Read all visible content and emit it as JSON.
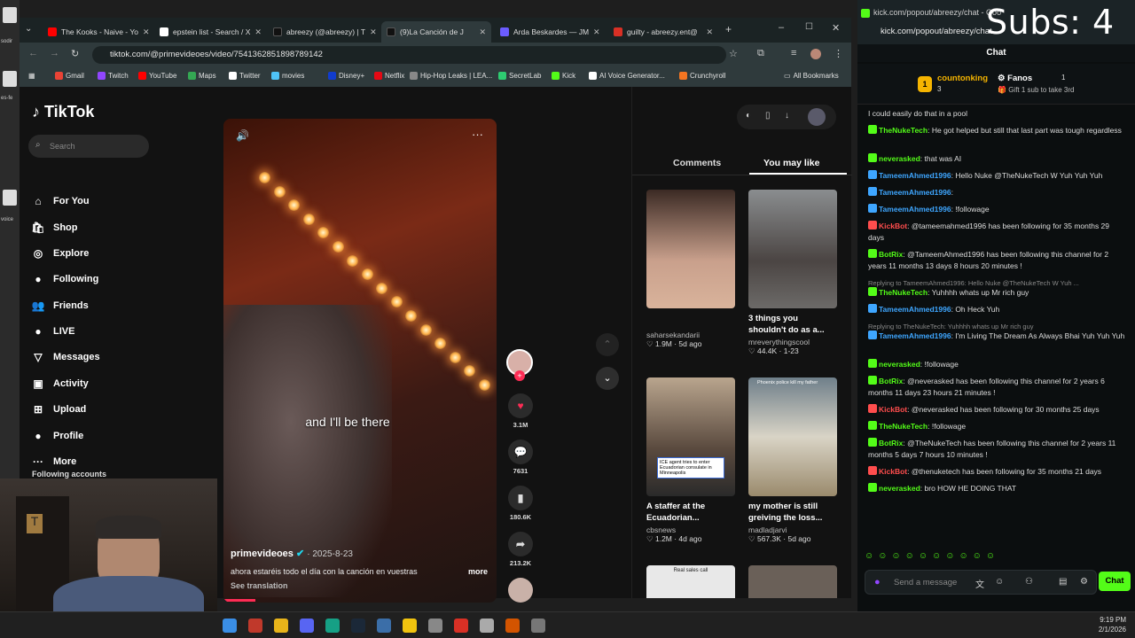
{
  "overlay": {
    "subs": "Subs: 4"
  },
  "desktop": {
    "icons": [
      "sodir",
      "es-fe",
      "voice"
    ]
  },
  "browser": {
    "tabs": [
      {
        "label": "The Kooks - Naive - Yo",
        "color": "#ff0000"
      },
      {
        "label": "epstein list - Search / X",
        "color": "#ffffff"
      },
      {
        "label": "abreezy (@abreezy) | T",
        "color": "#111111"
      },
      {
        "label": "(9)La Canción de J",
        "color": "#111111"
      },
      {
        "label": "Arda Beskardes — JM",
        "color": "#6b5cff"
      },
      {
        "label": "guilty - abreezy.ent@",
        "color": "#d93025"
      }
    ],
    "url": "tiktok.com/@primevideoes/video/7541362851898789142",
    "bookmarks": [
      {
        "label": "Gmail",
        "color": "#ea4335"
      },
      {
        "label": "Twitch",
        "color": "#9146ff"
      },
      {
        "label": "YouTube",
        "color": "#ff0000"
      },
      {
        "label": "Maps",
        "color": "#34a853"
      },
      {
        "label": "Twitter",
        "color": "#ffffff"
      },
      {
        "label": "movies",
        "color": "#4fc3f7"
      },
      {
        "label": "Disney+",
        "color": "#113ccf"
      },
      {
        "label": "Netflix",
        "color": "#e50914"
      },
      {
        "label": "Hip-Hop Leaks | LEA...",
        "color": "#888888"
      },
      {
        "label": "SecretLab",
        "color": "#2ecc71"
      },
      {
        "label": "Kick",
        "color": "#53fc18"
      },
      {
        "label": "AI Voice Generator...",
        "color": "#ffffff"
      },
      {
        "label": "Crunchyroll",
        "color": "#f47521"
      }
    ],
    "all_bookmarks": "All Bookmarks"
  },
  "tiktok": {
    "logo": "TikTok",
    "search_placeholder": "Search",
    "nav": [
      {
        "label": "For You",
        "icon": "⌂"
      },
      {
        "label": "Shop",
        "icon": "🛍"
      },
      {
        "label": "Explore",
        "icon": "◎"
      },
      {
        "label": "Following",
        "icon": "●"
      },
      {
        "label": "Friends",
        "icon": "👥"
      },
      {
        "label": "LIVE",
        "icon": "●"
      },
      {
        "label": "Messages",
        "icon": "▽"
      },
      {
        "label": "Activity",
        "icon": "▣"
      },
      {
        "label": "Upload",
        "icon": "⊞"
      },
      {
        "label": "Profile",
        "icon": "●"
      },
      {
        "label": "More",
        "icon": "···"
      }
    ],
    "following_accounts": "Following accounts",
    "video": {
      "caption": "and I'll be there",
      "author": "primevideoes",
      "date": "· 2025-8-23",
      "description": "ahora estaréis todo el día con la canción en vuestras",
      "more": "more",
      "see_translation": "See translation"
    },
    "actions": {
      "likes": "3.1M",
      "comments": "7631",
      "saves": "180.6K",
      "shares": "213.2K"
    },
    "panel_tabs": {
      "comments": "Comments",
      "you_may_like": "You may like"
    },
    "cards": [
      {
        "title": "",
        "author": "saharsekandarii",
        "stats": "♡ 1.9M · 5d ago",
        "color": "#c9a08c"
      },
      {
        "title": "3 things you shouldn't do as a...",
        "author": "mreverythingscool",
        "stats": "♡ 44.4K · 1-23",
        "color": "#6c6a68"
      },
      {
        "title": "A staffer at the Ecuadorian...",
        "author": "cbsnews",
        "stats": "♡ 1.2M · 4d ago",
        "color": "#8f7d6c"
      },
      {
        "title": "my mother is still greiving the loss...",
        "author": "madladjarvi",
        "stats": "♡ 567.3K · 5d ago",
        "color": "#b7a88f"
      }
    ],
    "card_overlays": {
      "ice": "ICE agent tries to enter Ecuadorian consulate in Minneapolis",
      "phoenix": "Phoenix police kill my father",
      "sales": "Real sales call"
    }
  },
  "kick": {
    "window_title": "kick.com/popout/abreezy/chat - Goo",
    "url": "kick.com/popout/abreezy/chat",
    "chat_title": "Chat",
    "leaderboard": [
      {
        "name": "countonking",
        "count": "3",
        "rank": "1"
      },
      {
        "name": "Fanos",
        "count": "1"
      }
    ],
    "gift_text": "Gift 1 sub to take 3rd",
    "messages": [
      {
        "user": "",
        "user_color": "#ffffff",
        "text": "I could easily do that in a pool"
      },
      {
        "user": "TheNukeTech",
        "user_color": "#53fc18",
        "text": "He got helped but still that last part was tough regardless"
      },
      {
        "user": "neverasked",
        "user_color": "#53fc18",
        "text": "that was AI"
      },
      {
        "user": "TameemAhmed1996",
        "user_color": "#3ea6ff",
        "text": "Hello Nuke @TheNukeTech W Yuh Yuh Yuh"
      },
      {
        "user": "TameemAhmed1996",
        "user_color": "#3ea6ff",
        "text": ""
      },
      {
        "user": "TameemAhmed1996",
        "user_color": "#3ea6ff",
        "text": "!followage"
      },
      {
        "user": "KickBot",
        "user_color": "#ff4d4d",
        "text": "@tameemahmed1996 has been following for 35 months 29 days"
      },
      {
        "user": "BotRix",
        "user_color": "#53fc18",
        "text": "@TameemAhmed1996 has been following this channel for 2 years 11 months 13 days 8 hours 20 minutes !"
      },
      {
        "user": "TheNukeTech",
        "user_color": "#53fc18",
        "text": "Yuhhhh whats up Mr rich guy",
        "reply": "Replying to TameemAhmed1996: Hello Nuke @TheNukeTech W Yuh ..."
      },
      {
        "user": "TameemAhmed1996",
        "user_color": "#3ea6ff",
        "text": "Oh Heck Yuh"
      },
      {
        "user": "TameemAhmed1996",
        "user_color": "#3ea6ff",
        "text": "I'm Living The Dream As Always Bhai Yuh Yuh Yuh",
        "reply": "Replying to TheNukeTech: Yuhhhh whats up Mr rich guy"
      },
      {
        "user": "neverasked",
        "user_color": "#53fc18",
        "text": "!followage"
      },
      {
        "user": "BotRix",
        "user_color": "#53fc18",
        "text": "@neverasked has been following this channel for 2 years 6 months 11 days 23 hours 21 minutes !"
      },
      {
        "user": "KickBot",
        "user_color": "#ff4d4d",
        "text": "@neverasked has been following for 30 months 25 days"
      },
      {
        "user": "TheNukeTech",
        "user_color": "#53fc18",
        "text": "!followage"
      },
      {
        "user": "BotRix",
        "user_color": "#53fc18",
        "text": "@TheNukeTech has been following this channel for 2 years 11 months 5 days 7 hours 10 minutes !"
      },
      {
        "user": "KickBot",
        "user_color": "#ff4d4d",
        "text": "@thenuketech has been following for 35 months 21 days"
      },
      {
        "user": "neverasked",
        "user_color": "#53fc18",
        "text": "bro HOW HE DOING THAT"
      }
    ],
    "input_placeholder": "Send a message",
    "send_label": "Chat"
  },
  "taskbar": {
    "time": "9:19 PM",
    "date": "2/1/2026"
  }
}
